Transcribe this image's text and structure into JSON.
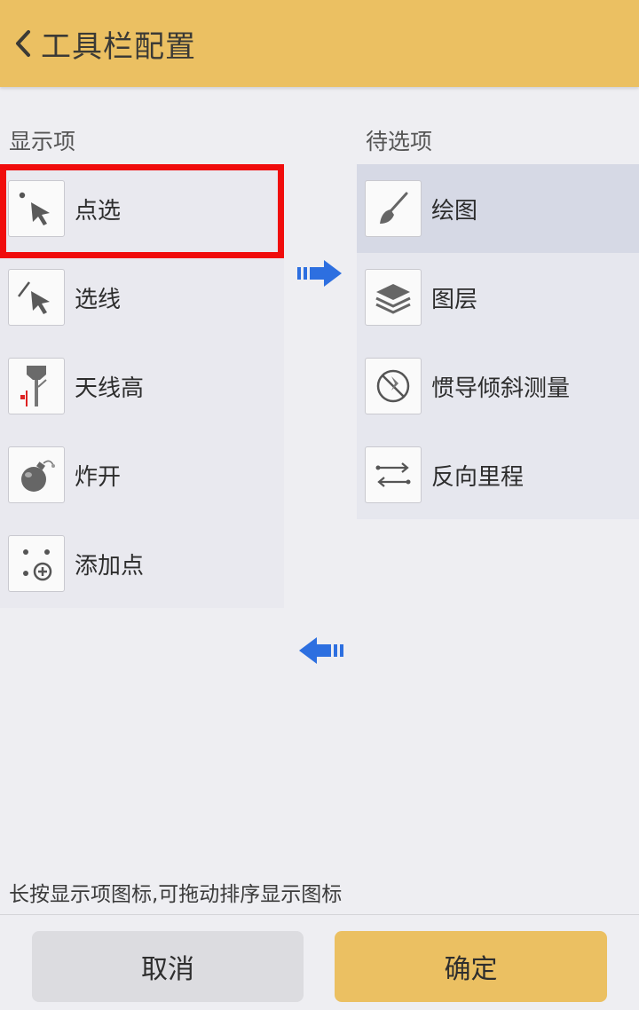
{
  "header": {
    "title": "工具栏配置",
    "back_icon": "chevron-left-icon",
    "color": "#ebc062"
  },
  "display_column": {
    "label": "显示项",
    "items": [
      {
        "label": "点选",
        "icon": "point-select-icon"
      },
      {
        "label": "选线",
        "icon": "line-select-icon"
      },
      {
        "label": "天线高",
        "icon": "antenna-height-icon"
      },
      {
        "label": "炸开",
        "icon": "explode-icon"
      },
      {
        "label": "添加点",
        "icon": "add-point-icon"
      }
    ]
  },
  "candidate_column": {
    "label": "待选项",
    "items": [
      {
        "label": "绘图",
        "icon": "brush-icon"
      },
      {
        "label": "图层",
        "icon": "layers-icon"
      },
      {
        "label": "惯导倾斜测量",
        "icon": "tilt-measure-icon"
      },
      {
        "label": "反向里程",
        "icon": "reverse-mileage-icon"
      }
    ]
  },
  "arrows": {
    "move_right_icon": "arrow-right-icon",
    "move_left_icon": "arrow-left-icon",
    "color": "#2d6fe0"
  },
  "hint": "长按显示项图标,可拖动排序显示图标",
  "buttons": {
    "cancel_label": "取消",
    "ok_label": "确定"
  },
  "highlight_color": "#f00c0c"
}
